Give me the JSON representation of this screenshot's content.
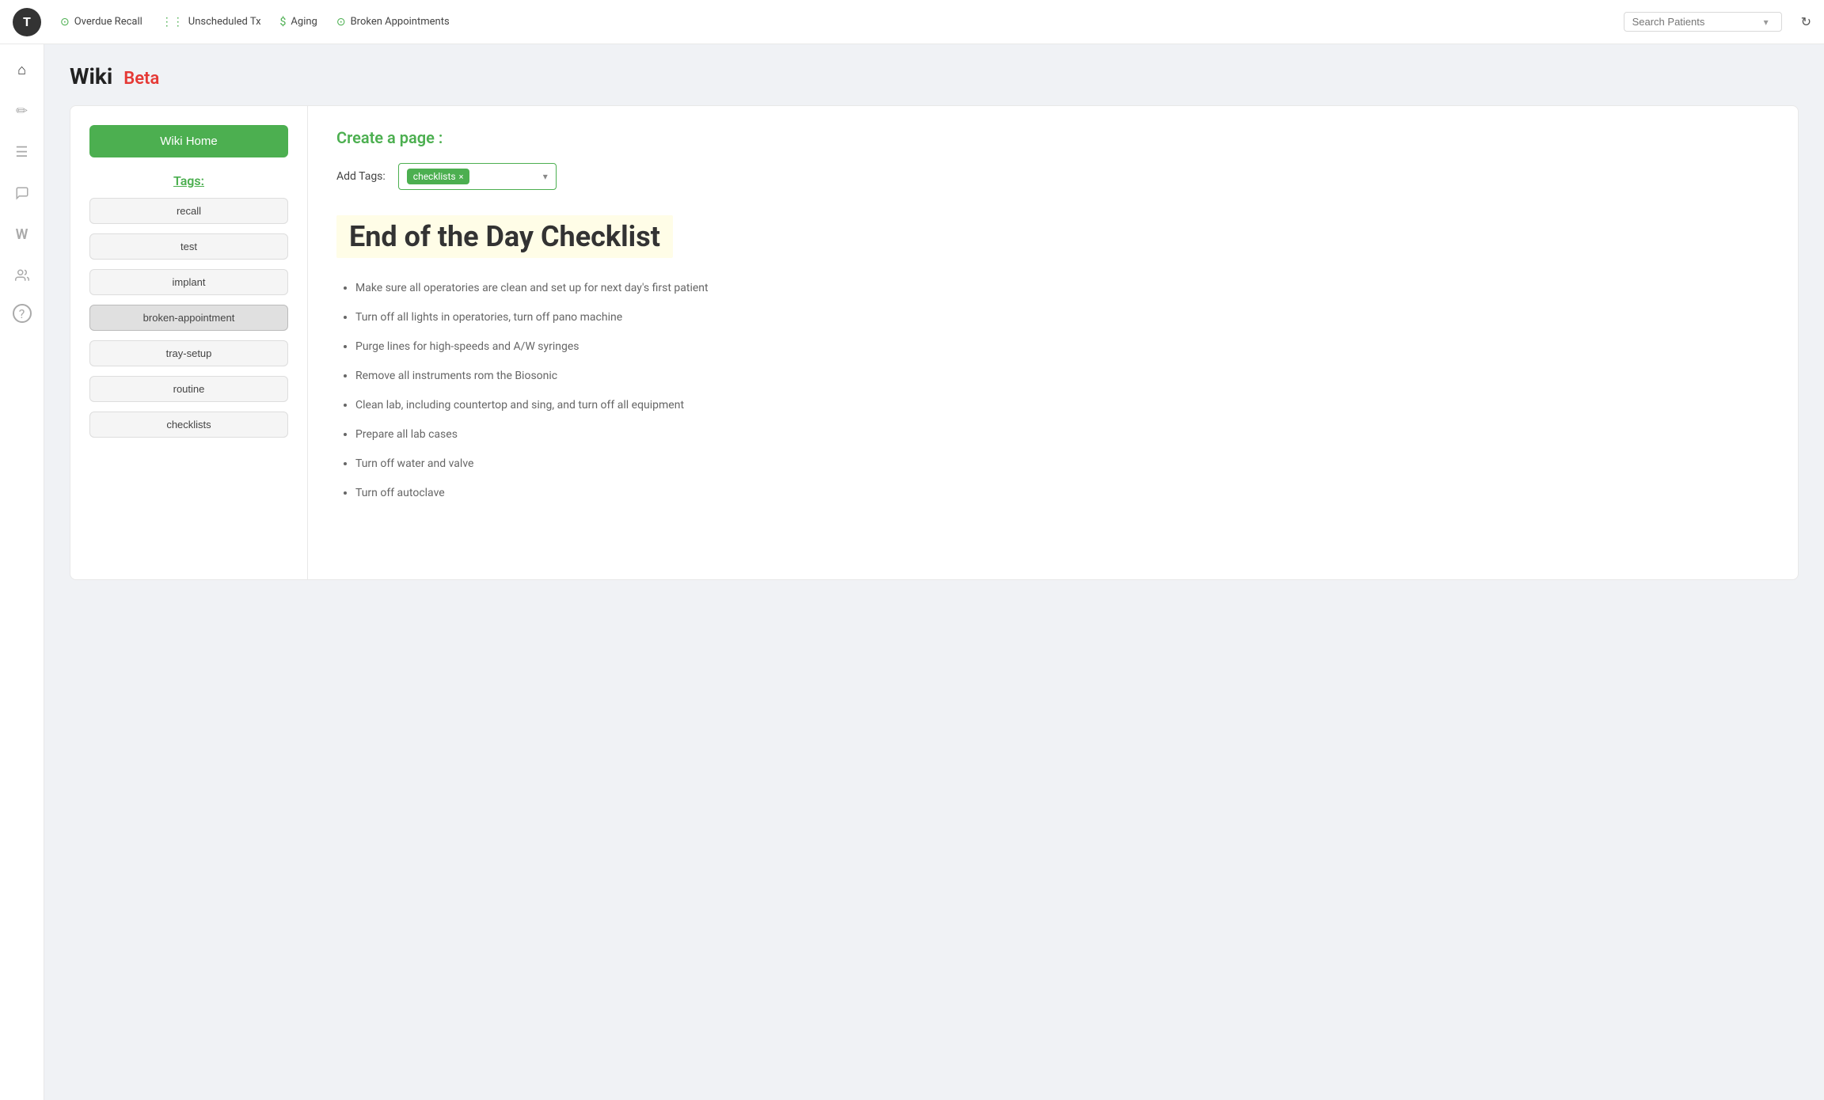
{
  "topNav": {
    "logo": "T",
    "items": [
      {
        "id": "overdue-recall",
        "label": "Overdue Recall",
        "icon": "⊙",
        "class": "overdue"
      },
      {
        "id": "unscheduled-tx",
        "label": "Unscheduled Tx",
        "icon": "≡",
        "class": "unscheduled"
      },
      {
        "id": "aging",
        "label": "Aging",
        "icon": "$",
        "class": "aging"
      },
      {
        "id": "broken-appointments",
        "label": "Broken Appointments",
        "icon": "⊙",
        "class": "broken"
      }
    ],
    "searchPlaceholder": "Search Patients",
    "refreshIcon": "↻"
  },
  "sidebar": {
    "icons": [
      {
        "id": "home",
        "symbol": "⌂"
      },
      {
        "id": "edit",
        "symbol": "✏"
      },
      {
        "id": "list",
        "symbol": "☰"
      },
      {
        "id": "chat",
        "symbol": "💬"
      },
      {
        "id": "wiki",
        "symbol": "W"
      },
      {
        "id": "team",
        "symbol": "👥"
      },
      {
        "id": "help",
        "symbol": "?"
      }
    ]
  },
  "pageTitle": "Wiki",
  "betaBadge": "Beta",
  "wikiSidebar": {
    "homeButton": "Wiki Home",
    "tagsHeading": "Tags:",
    "tags": [
      {
        "id": "recall",
        "label": "recall"
      },
      {
        "id": "test",
        "label": "test"
      },
      {
        "id": "implant",
        "label": "implant"
      },
      {
        "id": "broken-appointment",
        "label": "broken-appointment"
      },
      {
        "id": "tray-setup",
        "label": "tray-setup"
      },
      {
        "id": "routine",
        "label": "routine"
      },
      {
        "id": "checklists",
        "label": "checklists"
      }
    ]
  },
  "createPage": {
    "heading": "Create a page :",
    "addTagsLabel": "Add Tags:",
    "selectedTag": "checklists",
    "removeIcon": "×",
    "dropdownArrow": "▾"
  },
  "article": {
    "title": "End of the Day Checklist",
    "items": [
      "Make sure all operatories are clean and set up for next day's first patient",
      "Turn off all lights in operatories, turn off pano machine",
      "Purge lines for high-speeds and A/W syringes",
      "Remove all instruments rom the Biosonic",
      "Clean lab, including countertop and sing, and turn off all equipment",
      "Prepare all lab cases",
      "Turn off water and valve",
      "Turn off autoclave"
    ]
  }
}
